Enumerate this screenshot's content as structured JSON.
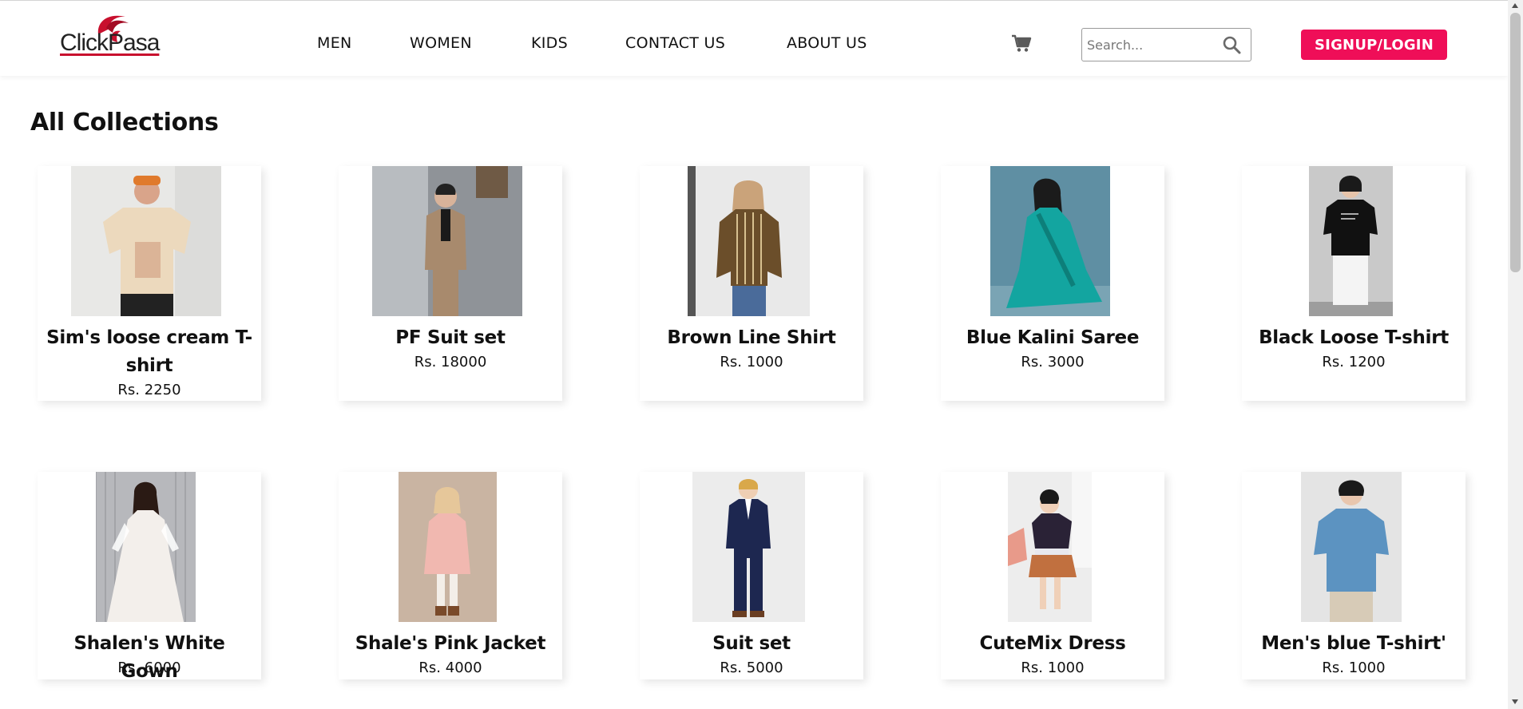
{
  "brand": {
    "logo_text": "ClickPasa",
    "accent_color": "#c8102e"
  },
  "nav": {
    "items": [
      {
        "label": "MEN"
      },
      {
        "label": "WOMEN"
      },
      {
        "label": "KIDS"
      },
      {
        "label": "CONTACT US"
      },
      {
        "label": "ABOUT US"
      }
    ],
    "cart_icon": "shopping-cart-icon"
  },
  "search": {
    "placeholder": "Search...",
    "value": "",
    "icon": "search-icon"
  },
  "signup": {
    "label": "SIGNUP/LOGIN",
    "color": "#ef0e58"
  },
  "page": {
    "title": "All Collections"
  },
  "products": [
    {
      "name": "Sim's loose cream T-shirt",
      "price": "Rs. 2250"
    },
    {
      "name": "PF Suit set",
      "price": "Rs. 18000"
    },
    {
      "name": "Brown Line Shirt",
      "price": "Rs. 1000"
    },
    {
      "name": "Blue Kalini Saree",
      "price": "Rs. 3000"
    },
    {
      "name": "Black Loose T-shirt",
      "price": "Rs. 1200"
    },
    {
      "name": "Shalen's White Gown",
      "price": "Rs. 6000"
    },
    {
      "name": "Shale's Pink Jacket",
      "price": "Rs. 4000"
    },
    {
      "name": "Suit set",
      "price": "Rs. 5000"
    },
    {
      "name": "CuteMix Dress",
      "price": "Rs. 1000"
    },
    {
      "name": "Men's blue T-shirt'",
      "price": "Rs. 1000"
    }
  ]
}
